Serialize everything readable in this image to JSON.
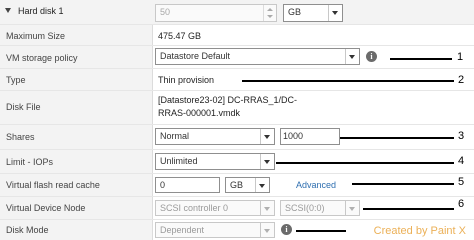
{
  "header": {
    "label": "Hard disk 1",
    "size_value": "50",
    "size_unit": "GB"
  },
  "rows": {
    "max_size": {
      "label": "Maximum Size",
      "value": "475.47 GB"
    },
    "storage_policy": {
      "label": "VM storage policy",
      "value": "Datastore Default",
      "icon": "info-icon"
    },
    "type": {
      "label": "Type",
      "value": "Thin provision"
    },
    "disk_file": {
      "label": "Disk File",
      "line1": "[Datastore23-02] DC-RRAS_1/DC-",
      "line2": "RRAS-000001.vmdk"
    },
    "shares": {
      "label": "Shares",
      "value": "Normal",
      "amount": "1000"
    },
    "limit_iops": {
      "label": "Limit - IOPs",
      "value": "Unlimited"
    },
    "flash_cache": {
      "label": "Virtual flash read cache",
      "value": "0",
      "unit": "GB",
      "link": "Advanced"
    },
    "device_node": {
      "label": "Virtual Device Node",
      "controller": "SCSI controller 0",
      "node": "SCSI(0:0)"
    },
    "disk_mode": {
      "label": "Disk Mode",
      "value": "Dependent",
      "icon": "info-icon"
    }
  },
  "callouts": [
    "1",
    "2",
    "3",
    "4",
    "5",
    "6"
  ],
  "watermark": "Created by Paint X"
}
